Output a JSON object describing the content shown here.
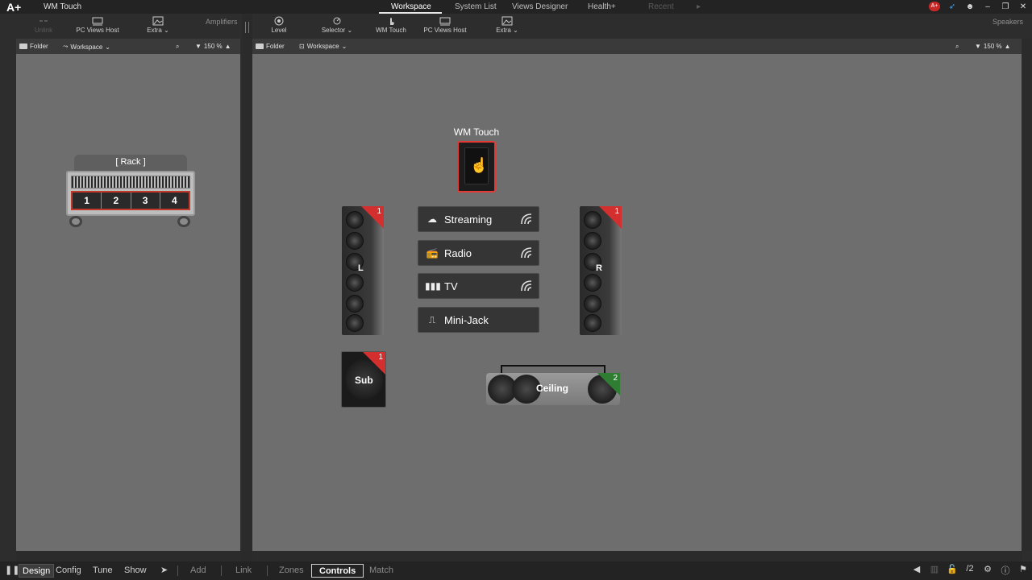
{
  "app": {
    "logo": "A+",
    "window_title": "WM Touch"
  },
  "tabs": [
    {
      "label": "Workspace"
    },
    {
      "label": "System List"
    },
    {
      "label": "Views Designer"
    },
    {
      "label": "Health+"
    },
    {
      "label": "Recent"
    }
  ],
  "left_toolbar": {
    "unlink": "Unlink",
    "pc_views_host": "PC Views Host",
    "extra": "Extra",
    "section_label": "Amplifiers"
  },
  "right_toolbar": {
    "level": "Level",
    "selector": "Selector",
    "wm_touch": "WM Touch",
    "pc_views_host": "PC Views Host",
    "extra": "Extra",
    "section_label": "Speakers"
  },
  "left_panel": {
    "folder": "Folder",
    "workspace": "Workspace",
    "zoom": "150 %"
  },
  "right_panel": {
    "folder": "Folder",
    "workspace": "Workspace",
    "zoom": "150 %"
  },
  "rack": {
    "title": "[ Rack ]",
    "slots": [
      "1",
      "2",
      "3",
      "4"
    ]
  },
  "wm_touch_device": {
    "label": "WM Touch"
  },
  "sources": [
    {
      "label": "Streaming",
      "icon": "cloud-icon"
    },
    {
      "label": "Radio",
      "icon": "radio-icon"
    },
    {
      "label": "TV",
      "icon": "waveform-icon"
    },
    {
      "label": "Mini-Jack",
      "icon": "jack-icon"
    }
  ],
  "speakers": {
    "left": {
      "label": "L",
      "count": "1"
    },
    "right": {
      "label": "R",
      "count": "1"
    },
    "sub": {
      "label": "Sub",
      "count": "1"
    },
    "ceiling": {
      "label": "Ceiling",
      "count": "2"
    }
  },
  "bottom_bar": {
    "design": "Design",
    "config": "Config",
    "tune": "Tune",
    "show": "Show",
    "add": "Add",
    "link": "Link",
    "zones": "Zones",
    "controls": "Controls",
    "match": "Match",
    "page_indicator": "/2"
  },
  "colors": {
    "accent_red": "#d32f2f",
    "accent_green": "#2e7d32",
    "canvas": "#6e6e6e"
  }
}
